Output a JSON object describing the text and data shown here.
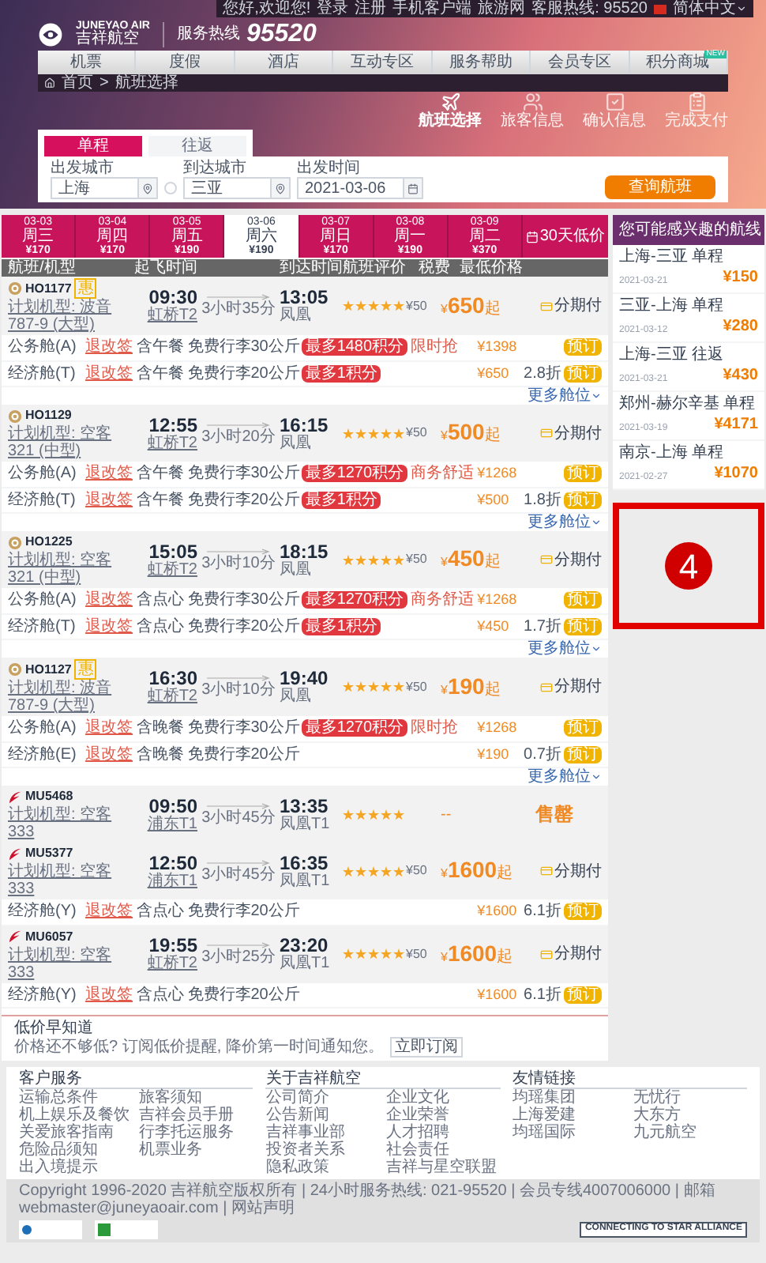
{
  "top_bar": {
    "links": [
      "您好,欢迎您!",
      "登录",
      "注册",
      "手机客户端",
      "旅游网",
      "客服热线: 95520"
    ],
    "language": "简体中文"
  },
  "brand": {
    "name_en": "JUNEYAO AIR",
    "name_cn": "吉祥航空",
    "hotline_label": "服务热线",
    "hotline": "95520"
  },
  "nav": [
    {
      "label": "机票"
    },
    {
      "label": "度假"
    },
    {
      "label": "酒店"
    },
    {
      "label": "互动专区"
    },
    {
      "label": "服务帮助"
    },
    {
      "label": "会员专区"
    },
    {
      "label": "积分商城",
      "badge": "NEW"
    }
  ],
  "breadcrumb": {
    "items": [
      "首页",
      "航班选择"
    ],
    "separator": ">"
  },
  "steps": [
    {
      "label": "航班选择",
      "selected": true
    },
    {
      "label": "旅客信息",
      "selected": false
    },
    {
      "label": "确认信息",
      "selected": false
    },
    {
      "label": "完成支付",
      "selected": false
    }
  ],
  "trip_tabs": [
    {
      "label": "单程",
      "selected": true
    },
    {
      "label": "往返",
      "selected": false
    }
  ],
  "search": {
    "fields": [
      {
        "kind": "city",
        "label": "出发城市",
        "value": "上海"
      },
      {
        "kind": "city",
        "label": "到达城市",
        "value": "三亚"
      },
      {
        "kind": "date",
        "label": "出发时间",
        "value": "2021-03-06"
      }
    ],
    "button": "查询航班"
  },
  "dates": [
    {
      "date": "03-03",
      "weekday": "周三",
      "price": "¥170",
      "selected": false
    },
    {
      "date": "03-04",
      "weekday": "周四",
      "price": "¥170",
      "selected": false
    },
    {
      "date": "03-05",
      "weekday": "周五",
      "price": "¥190",
      "selected": false
    },
    {
      "date": "03-06",
      "weekday": "周六",
      "price": "¥190",
      "selected": true
    },
    {
      "date": "03-07",
      "weekday": "周日",
      "price": "¥170",
      "selected": false
    },
    {
      "date": "03-08",
      "weekday": "周一",
      "price": "¥190",
      "selected": false
    },
    {
      "date": "03-09",
      "weekday": "周二",
      "price": "¥370",
      "selected": false
    }
  ],
  "calendar": {
    "label": "30天低价"
  },
  "table": {
    "columns": [
      "航班/机型",
      "起飞时间",
      "到达时间",
      "航班评价",
      "税费",
      "最低价格"
    ],
    "flights": [
      {
        "kind": "available",
        "logo": {
          "kind": "juneyao"
        },
        "number": "HO1177",
        "tag": "惠",
        "aircraft": "计划机型: 波音787-9 (大型)",
        "dep_time": "09:30",
        "dep_airport": "虹桥T2",
        "duration": "3小时35分",
        "arr_time": "13:05",
        "arr_airport": "凤凰",
        "stars": 5,
        "tax": "¥50",
        "currency": "¥",
        "price": "650",
        "price_suffix": "起",
        "installment": "分期付",
        "more": "更多舱位",
        "cabins": [
          {
            "cabin": "公务舱(A)",
            "rules": "退改签",
            "meal": "含午餐",
            "baggage": "免费行李30公斤",
            "points": "最多1480积分",
            "promo": "限时抢",
            "price": "¥1398",
            "button": "预订"
          },
          {
            "cabin": "经济舱(T)",
            "rules": "退改签",
            "meal": "含午餐",
            "baggage": "免费行李20公斤",
            "points": "最多1积分",
            "price": "¥650",
            "discount": "2.8折",
            "button": "预订"
          }
        ]
      },
      {
        "kind": "available",
        "logo": {
          "kind": "juneyao"
        },
        "number": "HO1129",
        "aircraft": "计划机型: 空客321 (中型)",
        "dep_time": "12:55",
        "dep_airport": "虹桥T2",
        "duration": "3小时20分",
        "arr_time": "16:15",
        "arr_airport": "凤凰",
        "stars": 5,
        "tax": "¥50",
        "currency": "¥",
        "price": "500",
        "price_suffix": "起",
        "installment": "分期付",
        "more": "更多舱位",
        "cabins": [
          {
            "cabin": "公务舱(A)",
            "rules": "退改签",
            "meal": "含午餐",
            "baggage": "免费行李30公斤",
            "points": "最多1270积分",
            "promo": "商务舒适",
            "price": "¥1268",
            "button": "预订"
          },
          {
            "cabin": "经济舱(T)",
            "rules": "退改签",
            "meal": "含午餐",
            "baggage": "免费行李20公斤",
            "points": "最多1积分",
            "price": "¥500",
            "discount": "1.8折",
            "button": "预订"
          }
        ]
      },
      {
        "kind": "available",
        "logo": {
          "kind": "juneyao"
        },
        "number": "HO1225",
        "aircraft": "计划机型: 空客321 (中型)",
        "dep_time": "15:05",
        "dep_airport": "虹桥T2",
        "duration": "3小时10分",
        "arr_time": "18:15",
        "arr_airport": "凤凰",
        "stars": 5,
        "tax": "¥50",
        "currency": "¥",
        "price": "450",
        "price_suffix": "起",
        "installment": "分期付",
        "more": "更多舱位",
        "cabins": [
          {
            "cabin": "公务舱(A)",
            "rules": "退改签",
            "meal": "含点心",
            "baggage": "免费行李30公斤",
            "points": "最多1270积分",
            "promo": "商务舒适",
            "price": "¥1268",
            "button": "预订"
          },
          {
            "cabin": "经济舱(T)",
            "rules": "退改签",
            "meal": "含点心",
            "baggage": "免费行李20公斤",
            "points": "最多1积分",
            "price": "¥450",
            "discount": "1.7折",
            "button": "预订"
          }
        ]
      },
      {
        "kind": "available",
        "logo": {
          "kind": "juneyao"
        },
        "number": "HO1127",
        "tag": "惠",
        "aircraft": "计划机型: 波音787-9 (大型)",
        "dep_time": "16:30",
        "dep_airport": "虹桥T2",
        "duration": "3小时10分",
        "arr_time": "19:40",
        "arr_airport": "凤凰",
        "stars": 5,
        "tax": "¥50",
        "currency": "¥",
        "price": "190",
        "price_suffix": "起",
        "installment": "分期付",
        "more": "更多舱位",
        "cabins": [
          {
            "cabin": "公务舱(A)",
            "rules": "退改签",
            "meal": "含晚餐",
            "baggage": "免费行李30公斤",
            "points": "最多1270积分",
            "promo": "限时抢",
            "price": "¥1268",
            "button": "预订"
          },
          {
            "cabin": "经济舱(E)",
            "rules": "退改签",
            "meal": "含晚餐",
            "baggage": "免费行李20公斤",
            "price": "¥190",
            "discount": "0.7折",
            "button": "预订"
          }
        ]
      },
      {
        "kind": "sold_out",
        "logo": {
          "kind": "eastern"
        },
        "number": "MU5468",
        "aircraft": "计划机型: 空客333",
        "dep_time": "09:50",
        "dep_airport": "浦东T1",
        "duration": "3小时45分",
        "arr_time": "13:35",
        "arr_airport": "凤凰T1",
        "stars": 5,
        "price": "--",
        "status": "售罄"
      },
      {
        "kind": "available",
        "logo": {
          "kind": "eastern"
        },
        "number": "MU5377",
        "aircraft": "计划机型: 空客333",
        "dep_time": "12:50",
        "dep_airport": "浦东T1",
        "duration": "3小时45分",
        "arr_time": "16:35",
        "arr_airport": "凤凰T1",
        "stars": 5,
        "tax": "¥50",
        "currency": "¥",
        "price": "1600",
        "price_suffix": "起",
        "installment": "分期付",
        "cabins": [
          {
            "cabin": "经济舱(Y)",
            "rules": "退改签",
            "meal": "含点心",
            "baggage": "免费行李20公斤",
            "price": "¥1600",
            "discount": "6.1折",
            "button": "预订"
          }
        ]
      },
      {
        "kind": "available",
        "logo": {
          "kind": "eastern"
        },
        "number": "MU6057",
        "aircraft": "计划机型: 空客333",
        "dep_time": "19:55",
        "dep_airport": "虹桥T2",
        "duration": "3小时25分",
        "arr_time": "23:20",
        "arr_airport": "凤凰T1",
        "stars": 5,
        "tax": "¥50",
        "currency": "¥",
        "price": "1600",
        "price_suffix": "起",
        "installment": "分期付",
        "cabins": [
          {
            "cabin": "经济舱(Y)",
            "rules": "退改签",
            "meal": "含点心",
            "baggage": "免费行李20公斤",
            "price": "¥1600",
            "discount": "6.1折",
            "button": "预订"
          }
        ]
      }
    ]
  },
  "notice": {
    "title": "低价早知道",
    "text": "价格还不够低? 订阅低价提醒, 降价第一时间通知您。",
    "button": "立即订阅"
  },
  "sidebar": {
    "title": "您可能感兴趣的航线",
    "routes": [
      {
        "route": "上海-三亚 单程",
        "date": "2021-03-21",
        "price": "¥150"
      },
      {
        "route": "三亚-上海 单程",
        "date": "2021-03-12",
        "price": "¥280"
      },
      {
        "route": "上海-三亚 往返",
        "date": "2021-03-21",
        "price": "¥430"
      },
      {
        "route": "郑州-赫尔辛基 单程",
        "date": "2021-03-19",
        "price": "¥4171"
      },
      {
        "route": "南京-上海 单程",
        "date": "2021-02-27",
        "price": "¥1070"
      }
    ]
  },
  "annotation": {
    "label": "4"
  },
  "footer": {
    "sections": [
      {
        "title": "客户服务",
        "links": [
          "运输总条件",
          "旅客须知",
          "机上娱乐及餐饮",
          "吉祥会员手册",
          "关爱旅客指南",
          "行李托运服务",
          "危险品须知",
          "机票业务",
          "出入境提示"
        ]
      },
      {
        "title": "关于吉祥航空",
        "links": [
          "公司简介",
          "企业文化",
          "公告新闻",
          "企业荣誉",
          "吉祥事业部",
          "人才招聘",
          "投资者关系",
          "社会责任",
          "隐私政策",
          "吉祥与星空联盟"
        ]
      },
      {
        "title": "友情链接",
        "links": [
          "均瑶集团",
          "无忧行",
          "上海爱建",
          "大东方",
          "均瑶国际",
          "九元航空"
        ]
      }
    ],
    "copyright": "Copyright 1996-2020 吉祥航空版权所有 | 24小时服务热线: 021-95520 | 会员专线4007006000 | 邮箱webmaster@juneyaoair.com | 网站声明",
    "star_alliance": "CONNECTING TO STAR ALLIANCE"
  }
}
